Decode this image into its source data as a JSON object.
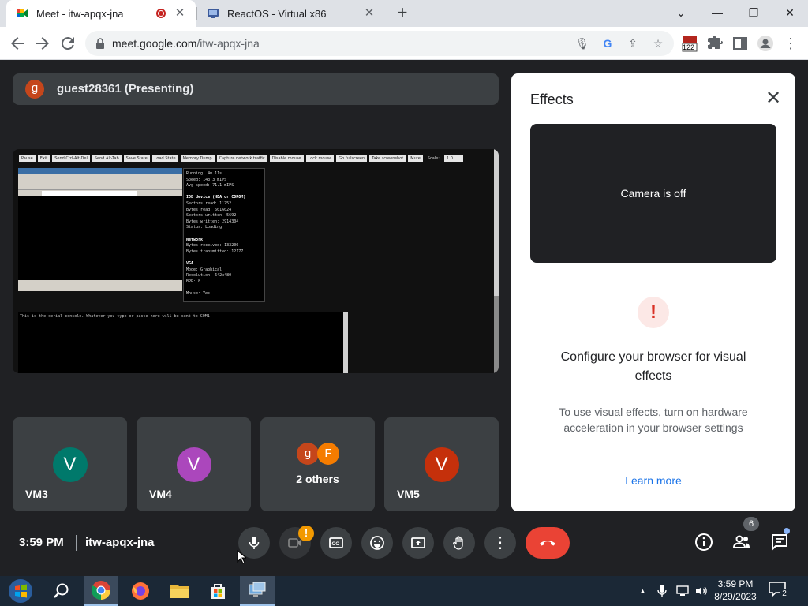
{
  "browser": {
    "tabs": [
      {
        "title": "Meet - itw-apqx-jna",
        "recording": true
      },
      {
        "title": "ReactOS - Virtual x86"
      }
    ],
    "url_host": "meet.google.com",
    "url_path": "/itw-apqx-jna",
    "extension_badge": "122"
  },
  "meet": {
    "presenter": {
      "initial": "g",
      "name": "guest28361 (Presenting)"
    },
    "shared_screen": {
      "buttons": [
        "Pause",
        "Exit",
        "Send Ctrl-Alt-Del",
        "Send Alt-Tab",
        "Save State",
        "Load State",
        "Memory Dump",
        "Capture network traffic",
        "Disable mouse",
        "Lock mouse",
        "Go fullscreen",
        "Take screenshot",
        "Mute"
      ],
      "scale_label": "Scale:",
      "scale_value": "1.0",
      "stats": [
        {
          "t": "Running: 4m 11s",
          "h": false
        },
        {
          "t": "Speed: 143.3 mIPS",
          "h": false
        },
        {
          "t": "Avg speed: 71.1 mIPS",
          "h": false
        },
        {
          "t": "",
          "h": false
        },
        {
          "t": "IDE device (HDA or CDROM)",
          "h": true
        },
        {
          "t": "Sectors read: 11752",
          "h": false
        },
        {
          "t": "Bytes read: 6016024",
          "h": false
        },
        {
          "t": "Sectors written: 5692",
          "h": false
        },
        {
          "t": "Bytes written: 2914304",
          "h": false
        },
        {
          "t": "Status: Loading",
          "h": false
        },
        {
          "t": "",
          "h": false
        },
        {
          "t": "Network",
          "h": true
        },
        {
          "t": "Bytes received: 133200",
          "h": false
        },
        {
          "t": "Bytes transmitted: 12177",
          "h": false
        },
        {
          "t": "",
          "h": false
        },
        {
          "t": "VGA",
          "h": true
        },
        {
          "t": "Mode: Graphical",
          "h": false
        },
        {
          "t": "Resolution: 642x480",
          "h": false
        },
        {
          "t": "BPP: 8",
          "h": false
        },
        {
          "t": "",
          "h": false
        },
        {
          "t": "Mouse: Yes",
          "h": false
        }
      ],
      "console_text": "This is the serial console. Whatever you type or paste here will be sent to COM1"
    },
    "tiles": [
      {
        "initial": "V",
        "label": "VM3",
        "color": "#00796b"
      },
      {
        "initial": "V",
        "label": "VM4",
        "color": "#ab47bc"
      },
      {
        "label": "2 others",
        "initials": [
          "g",
          "F"
        ],
        "colors": [
          "#c5461b",
          "#f57c00"
        ]
      },
      {
        "initial": "V",
        "label": "VM5",
        "color": "#c5300b"
      }
    ],
    "effects_panel": {
      "title": "Effects",
      "camera_status": "Camera is off",
      "warning_icon": "!",
      "heading": "Configure your browser for visual effects",
      "description": "To use visual effects, turn on hardware acceleration in your browser settings",
      "link": "Learn more"
    },
    "controls": {
      "time": "3:59 PM",
      "meeting_code": "itw-apqx-jna",
      "camera_badge": "!",
      "people_count": "6",
      "end_call_color": "#ea4335"
    }
  },
  "taskbar": {
    "time": "3:59 PM",
    "date": "8/29/2023",
    "notification_count": "2"
  }
}
